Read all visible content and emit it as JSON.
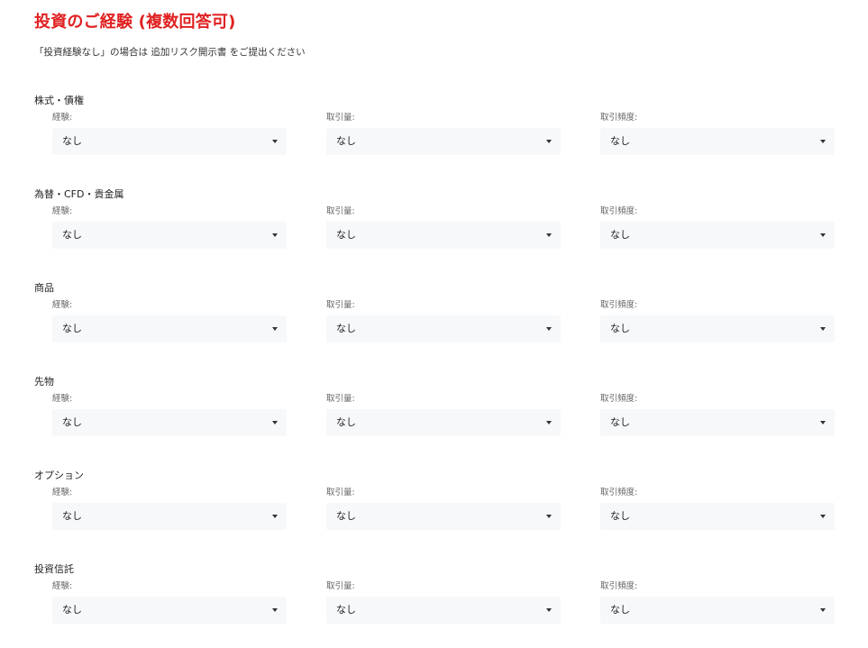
{
  "page": {
    "title": "投資のご経験 (複数回答可)",
    "notice": "「投資経験なし」の場合は 追加リスク開示書 をご提出ください"
  },
  "field_labels": {
    "experience": "経験:",
    "volume": "取引量:",
    "frequency": "取引頻度:"
  },
  "sections": [
    {
      "title": "株式・債権",
      "experience": "なし",
      "volume": "なし",
      "frequency": "なし"
    },
    {
      "title": "為替・CFD・貴金属",
      "experience": "なし",
      "volume": "なし",
      "frequency": "なし"
    },
    {
      "title": "商品",
      "experience": "なし",
      "volume": "なし",
      "frequency": "なし"
    },
    {
      "title": "先物",
      "experience": "なし",
      "volume": "なし",
      "frequency": "なし"
    },
    {
      "title": "オプション",
      "experience": "なし",
      "volume": "なし",
      "frequency": "なし"
    },
    {
      "title": "投資信託",
      "experience": "なし",
      "volume": "なし",
      "frequency": "なし"
    }
  ],
  "colors": {
    "title": "#e02020",
    "select_background": "#f7f8fa"
  },
  "icons": {
    "select_arrow": "caret-down-icon"
  }
}
